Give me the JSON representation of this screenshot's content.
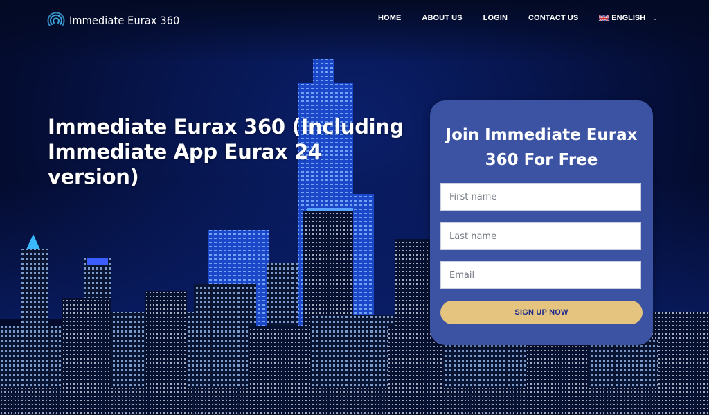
{
  "header": {
    "logo_text": "Immediate Eurax 360",
    "nav": [
      {
        "label": "HOME"
      },
      {
        "label": "ABOUT US"
      },
      {
        "label": "LOGIN"
      },
      {
        "label": "CONTACT US"
      }
    ],
    "language": {
      "label": "ENGLISH",
      "flag": "uk-flag-icon"
    }
  },
  "hero": {
    "title": "Immediate Eurax 360 (Including Immediate App Eurax 24 version)"
  },
  "signup_form": {
    "title": "Join Immediate Eurax 360 For Free",
    "first_name": {
      "placeholder": "First name",
      "value": ""
    },
    "last_name": {
      "placeholder": "Last name",
      "value": ""
    },
    "email": {
      "placeholder": "Email",
      "value": ""
    },
    "submit_label": "SIGN UP NOW"
  },
  "colors": {
    "card_bg": "#3c52a3",
    "button_bg": "#e4c47e",
    "button_text": "#1f2a8a",
    "page_bg": "#050d2e"
  }
}
